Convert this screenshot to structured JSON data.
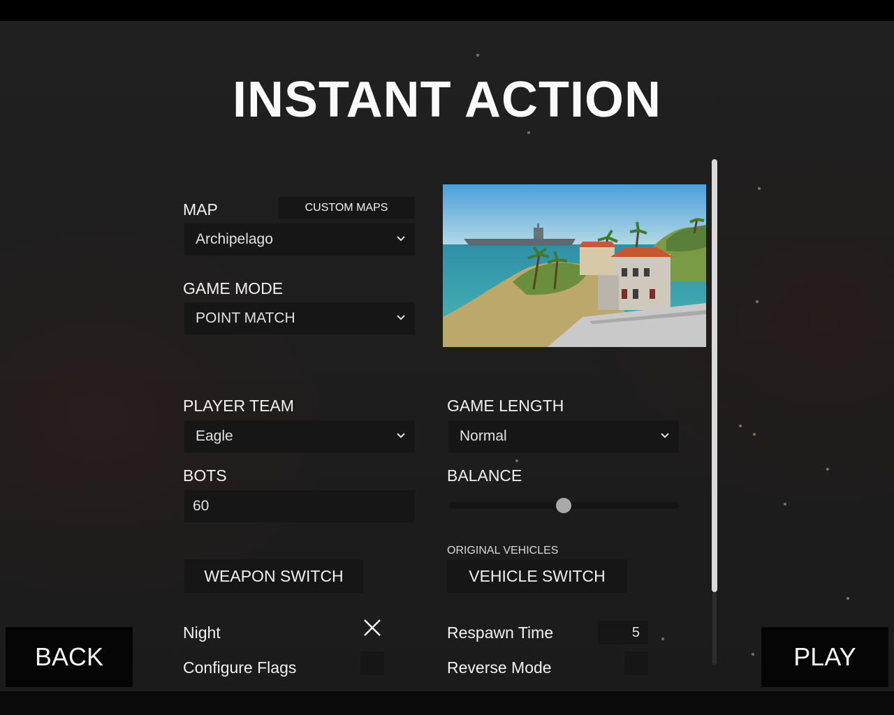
{
  "title": "INSTANT ACTION",
  "map": {
    "label": "MAP",
    "custom_maps_label": "CUSTOM MAPS",
    "selected": "Archipelago"
  },
  "game_mode": {
    "label": "GAME MODE",
    "selected": "POINT MATCH"
  },
  "player_team": {
    "label": "PLAYER TEAM",
    "selected": "Eagle"
  },
  "game_length": {
    "label": "GAME LENGTH",
    "selected": "Normal"
  },
  "bots": {
    "label": "BOTS",
    "value": "60"
  },
  "balance": {
    "label": "BALANCE",
    "value": 0.5
  },
  "original_vehicles_label": "ORIGINAL VEHICLES",
  "weapon_switch_label": "WEAPON SWITCH",
  "vehicle_switch_label": "VEHICLE SWITCH",
  "night": {
    "label": "Night",
    "checked": true
  },
  "configure_flags": {
    "label": "Configure Flags",
    "checked": false
  },
  "respawn_time": {
    "label": "Respawn Time",
    "value": "5"
  },
  "reverse_mode": {
    "label": "Reverse Mode",
    "checked": false
  },
  "back_label": "BACK",
  "play_label": "PLAY",
  "icons": {
    "dropdown": "chevron-down-icon",
    "check": "close-icon"
  },
  "colors": {
    "background": "#1d1d1d",
    "panel": "#161616",
    "button": "#050505",
    "text": "#f1f1f1"
  }
}
